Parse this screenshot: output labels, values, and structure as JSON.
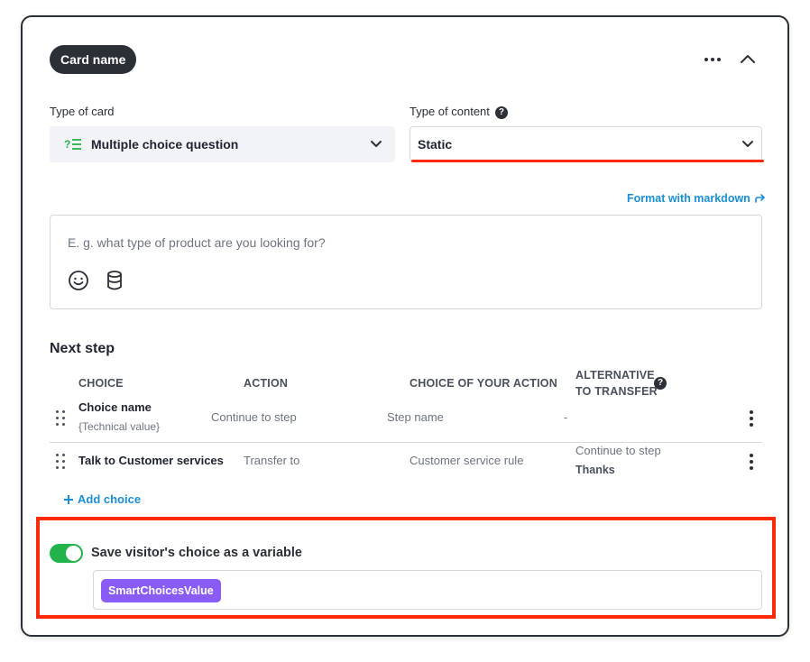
{
  "card": {
    "name": "Card name"
  },
  "type_of_card": {
    "label": "Type of card",
    "value": "Multiple choice question",
    "icon": "multiple-choice-icon"
  },
  "type_of_content": {
    "label": "Type of content",
    "help": "?",
    "value": "Static"
  },
  "message": {
    "format_link": "Format with markdown",
    "placeholder": "E. g. what type of product are you looking for?"
  },
  "next_step": {
    "title": "Next step",
    "headers": {
      "choice": "CHOICE",
      "action": "ACTION",
      "choice_of_action": "CHOICE OF YOUR ACTION",
      "alternative_line1": "ALTERNATIVE",
      "alternative_line2": "TO TRANSFER",
      "alternative_help": "?"
    },
    "rows": [
      {
        "choice": "Choice name",
        "technical": "{Technical value}",
        "action": "Continue to step",
        "choice_of_action": "Step name",
        "alternative": "-"
      },
      {
        "choice": "Talk to Customer services",
        "action": "Transfer to",
        "choice_of_action": "Customer service rule",
        "alternative_action": "Continue to step",
        "alternative_value": "Thanks"
      }
    ],
    "add_choice": "Add choice"
  },
  "save_variable": {
    "enabled": true,
    "label": "Save visitor's choice as a variable",
    "tag": "SmartChoicesValue"
  },
  "colors": {
    "accent_blue": "#1a8fd6",
    "toggle_green": "#23b34b",
    "tag_purple": "#8a5cf6",
    "highlight_red": "#ff2a0a",
    "dark": "#2b2f36"
  }
}
